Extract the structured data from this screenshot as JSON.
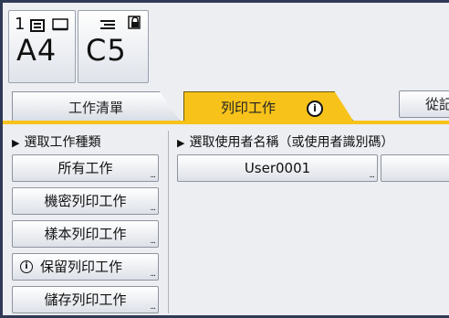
{
  "trays": [
    {
      "number": "1",
      "size": "A4"
    },
    {
      "size": "C5"
    }
  ],
  "tabs": {
    "job_list": "工作清單",
    "print_job": "列印工作"
  },
  "top_right_button": "從記",
  "left_panel": {
    "heading": "選取工作種類",
    "buttons": [
      "所有工作",
      "機密列印工作",
      "樣本列印工作",
      "保留列印工作",
      "儲存列印工作"
    ]
  },
  "right_panel": {
    "heading": "選取使用者名稱（或使用者識別碼）",
    "users": [
      "User0001",
      ""
    ]
  },
  "colors": {
    "accent": "#f7c21a",
    "frame": "#2f3a55",
    "background": "#eceef2"
  },
  "icons": [
    "document-stack-icon",
    "paper-icon",
    "envelope-icon",
    "lock-icon",
    "info-icon"
  ]
}
